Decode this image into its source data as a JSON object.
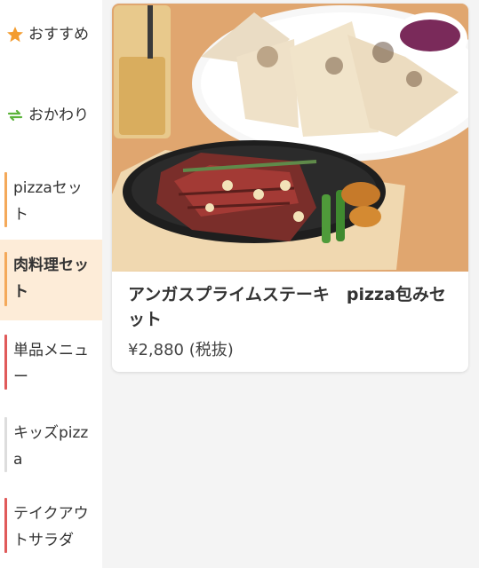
{
  "sidebar": {
    "top_items": [
      {
        "label": "おすすめ",
        "icon": "star-icon",
        "color": "#f39c2f"
      },
      {
        "label": "おかわり",
        "icon": "refresh-icon",
        "color": "#5bb33a"
      }
    ],
    "categories": [
      {
        "label": "pizzaセット",
        "bar_color": "#f4a95a",
        "active": false
      },
      {
        "label": "肉料理セット",
        "bar_color": "#f4a95a",
        "active": true
      },
      {
        "label": "単品メニュー",
        "bar_color": "#e05a5a",
        "active": false
      },
      {
        "label": "キッズpizza",
        "bar_color": "#dddddd",
        "active": false
      },
      {
        "label": "テイクアウトサラダ",
        "bar_color": "#e05a5a",
        "active": false
      }
    ]
  },
  "product": {
    "name": "アンガスプライムステーキ　pizza包みセット",
    "price": "¥2,880 (税抜)"
  },
  "colors": {
    "accent": "#f39c2f",
    "active_bg": "#fdecd8"
  }
}
